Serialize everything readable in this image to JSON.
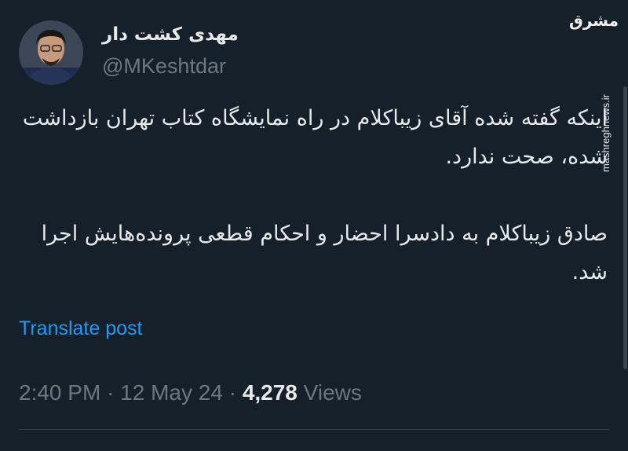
{
  "author": {
    "display_name": "مهدی کشت دار",
    "handle": "@MKeshtdar",
    "avatar_icon": "user-photo-icon"
  },
  "tweet": {
    "paragraphs": [
      "اینکه گفته شده آقای زیباکلام در راه نمایشگاه کتاب تهران بازداشت شده، صحت ندارد.",
      "صادق زیباکلام به دادسرا احضار و احکام قطعی پرونده‌هایش اجرا شد."
    ],
    "translate_label": "Translate post",
    "time": "2:40 PM",
    "separator": "·",
    "date": "12 May 24",
    "views_count": "4,278",
    "views_label": "Views"
  },
  "watermark": {
    "logo": "مشرق",
    "url": "mashreghnews.ir"
  },
  "colors": {
    "background": "#15202b",
    "text_primary": "#e7e9ea",
    "text_secondary": "#71767b",
    "link": "#1d9bf0",
    "divider": "#38444d"
  }
}
